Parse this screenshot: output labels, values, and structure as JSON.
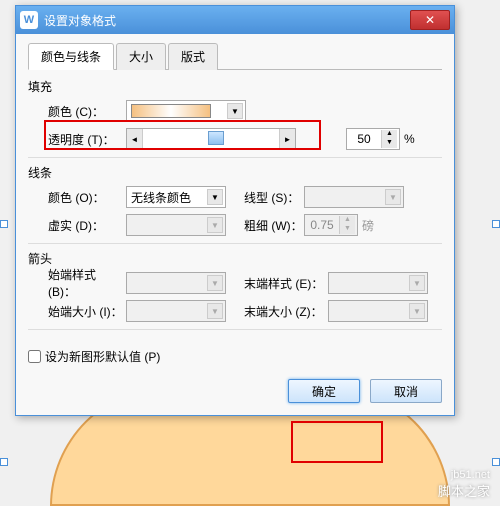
{
  "dialog": {
    "title": "设置对象格式"
  },
  "tabs": {
    "t1": "颜色与线条",
    "t2": "大小",
    "t3": "版式"
  },
  "fill": {
    "group": "填充",
    "color_label": "颜色 (C)：",
    "transparency_label": "透明度 (T)：",
    "transparency_value": "50",
    "transparency_unit": "%"
  },
  "line": {
    "group": "线条",
    "color_label": "颜色 (O)：",
    "color_value": "无线条颜色",
    "style_label": "线型 (S)：",
    "dash_label": "虚实 (D)：",
    "weight_label": "粗细 (W)：",
    "weight_value": "0.75",
    "weight_unit": "磅"
  },
  "arrow": {
    "group": "箭头",
    "begin_style": "始端样式 (B)：",
    "end_style": "末端样式 (E)：",
    "begin_size": "始端大小 (I)：",
    "end_size": "末端大小 (Z)："
  },
  "footer": {
    "default_chk": "设为新图形默认值 (P)",
    "ok": "确定",
    "cancel": "取消"
  },
  "watermark": {
    "url": "jb51.net",
    "name": "脚本之家"
  }
}
